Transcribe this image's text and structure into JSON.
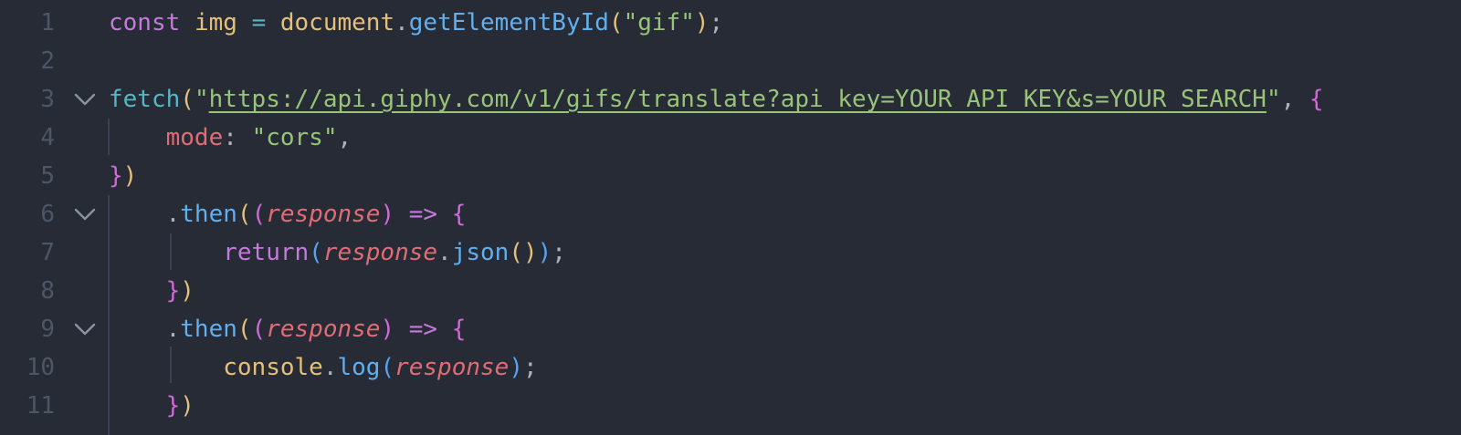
{
  "editor": {
    "theme_colors": {
      "background": "#262b35",
      "line_number": "#4e5665",
      "keyword": "#c678dd",
      "variable": "#e5c07b",
      "function": "#61afef",
      "string": "#98c379",
      "property": "#e06c75"
    },
    "fold_icon": "chevron-down-icon",
    "lines": [
      {
        "number": "1",
        "tokens": [
          "const",
          " ",
          "img",
          " ",
          "=",
          " ",
          "document",
          ".",
          "getElementById",
          "(",
          "\"gif\"",
          ")",
          ";"
        ]
      },
      {
        "number": "2",
        "tokens": []
      },
      {
        "number": "3",
        "tokens": [
          "fetch",
          "(",
          "\"",
          "https://api.giphy.com/v1/gifs/translate?api_key=YOUR_API_KEY&s=YOUR_SEARCH",
          "\"",
          ", ",
          "{"
        ]
      },
      {
        "number": "4",
        "tokens": [
          "    ",
          "mode",
          ": ",
          "\"cors\"",
          ","
        ]
      },
      {
        "number": "5",
        "tokens": [
          "}",
          ")"
        ]
      },
      {
        "number": "6",
        "tokens": [
          "    ",
          ".",
          "then",
          "(",
          "(",
          "response",
          ")",
          " ",
          "=>",
          " ",
          "{"
        ]
      },
      {
        "number": "7",
        "tokens": [
          "        ",
          "return",
          "(",
          "response",
          ".",
          "json",
          "(",
          ")",
          ")",
          ";"
        ]
      },
      {
        "number": "8",
        "tokens": [
          "    ",
          "}",
          ")"
        ]
      },
      {
        "number": "9",
        "tokens": [
          "    ",
          ".",
          "then",
          "(",
          "(",
          "response",
          ")",
          " ",
          "=>",
          " ",
          "{"
        ]
      },
      {
        "number": "10",
        "tokens": [
          "        ",
          "console",
          ".",
          "log",
          "(",
          "response",
          ")",
          ";"
        ]
      },
      {
        "number": "11",
        "tokens": [
          "    ",
          "}",
          ")"
        ]
      }
    ]
  }
}
